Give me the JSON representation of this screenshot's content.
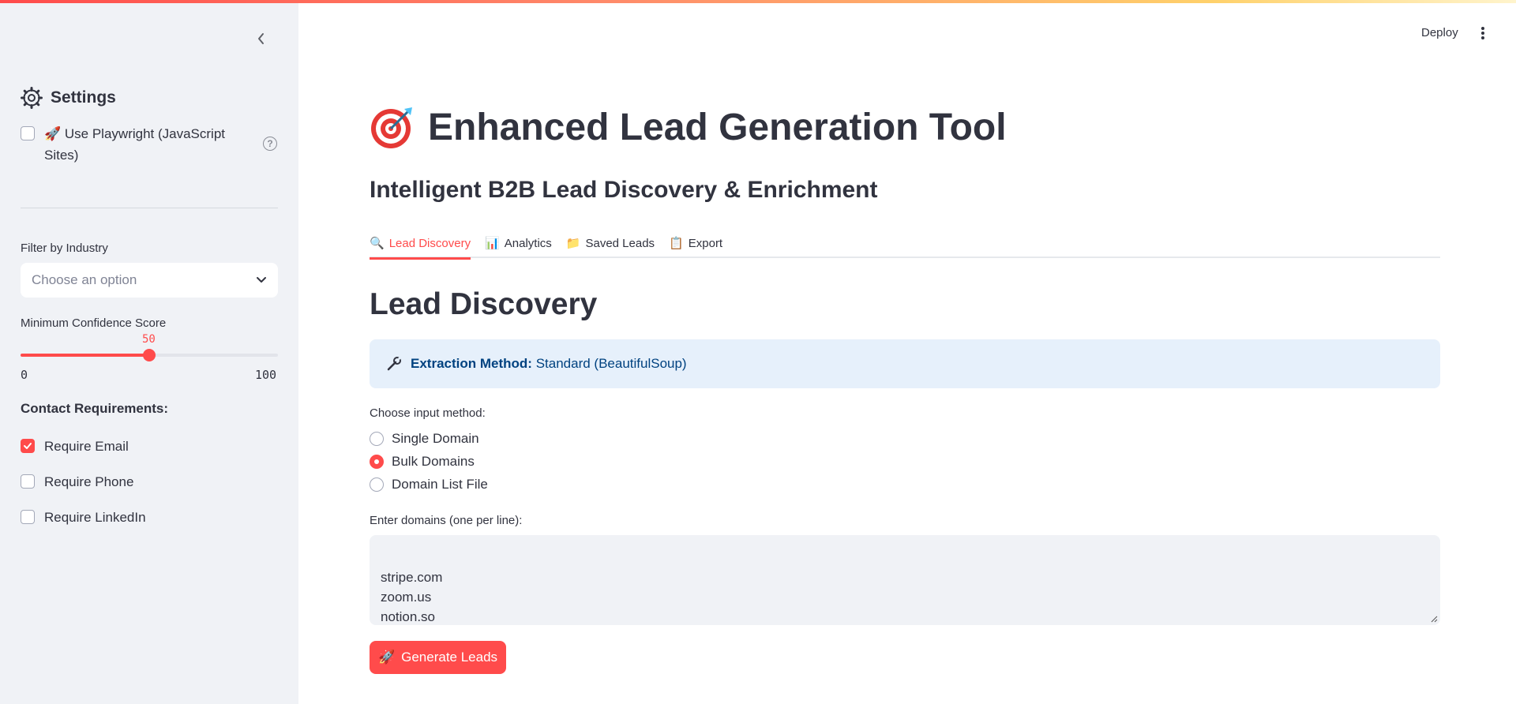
{
  "sidebar": {
    "settings_title": "Settings",
    "playwright_label": "🚀 Use Playwright (JavaScript Sites)",
    "playwright_checked": false,
    "industry_label": "Filter by Industry",
    "industry_placeholder": "Choose an option",
    "confidence_label": "Minimum Confidence Score",
    "confidence_value": "50",
    "confidence_min": "0",
    "confidence_max": "100",
    "contact_title": "Contact Requirements:",
    "requirements": [
      {
        "label": "Require Email",
        "checked": true
      },
      {
        "label": "Require Phone",
        "checked": false
      },
      {
        "label": "Require LinkedIn",
        "checked": false
      }
    ]
  },
  "header": {
    "deploy_label": "Deploy"
  },
  "main": {
    "title_emoji": "🎯",
    "title": "Enhanced Lead Generation Tool",
    "subtitle": "Intelligent B2B Lead Discovery & Enrichment",
    "tabs": [
      {
        "icon": "🔍",
        "label": "Lead Discovery",
        "active": true
      },
      {
        "icon": "📊",
        "label": "Analytics",
        "active": false
      },
      {
        "icon": "📁",
        "label": "Saved Leads",
        "active": false
      },
      {
        "icon": "📋",
        "label": "Export",
        "active": false
      }
    ],
    "section_title": "Lead Discovery",
    "info": {
      "label": "Extraction Method:",
      "value": "Standard (BeautifulSoup)"
    },
    "input_method_label": "Choose input method:",
    "input_methods": [
      {
        "label": "Single Domain",
        "selected": false
      },
      {
        "label": "Bulk Domains",
        "selected": true
      },
      {
        "label": "Domain List File",
        "selected": false
      }
    ],
    "domains_label": "Enter domains (one per line):",
    "domains_value": "stripe.com\nzoom.us\nnotion.so",
    "generate_icon": "🚀",
    "generate_label": "Generate Leads"
  },
  "colors": {
    "accent": "#ff4b4b",
    "sidebar_bg": "#f0f2f6",
    "info_bg": "#e6f0fb",
    "info_text": "#004280",
    "text": "#31333F"
  }
}
